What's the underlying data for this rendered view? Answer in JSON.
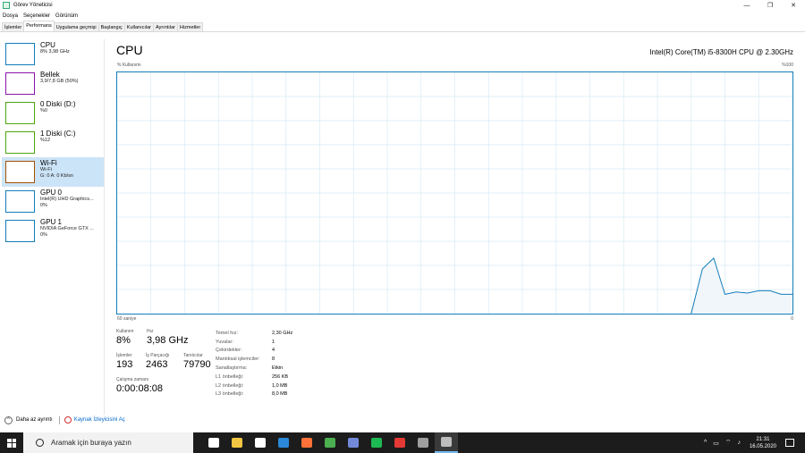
{
  "window": {
    "title": "Görev Yöneticisi",
    "controls": {
      "minimize": "—",
      "restore": "❐",
      "close": "✕"
    }
  },
  "menu": [
    "Dosya",
    "Seçenekler",
    "Görünüm"
  ],
  "tabs": [
    "İşlemler",
    "Performans",
    "Uygulama geçmişi",
    "Başlangıç",
    "Kullanıcılar",
    "Ayrıntılar",
    "Hizmetler"
  ],
  "active_tab": "Performans",
  "sidebar": {
    "items": [
      {
        "name": "CPU",
        "line1": "8%  3,98 GHz",
        "line2": "",
        "color": "#117dbb"
      },
      {
        "name": "Bellek",
        "line1": "3,9/7,8 GB (50%)",
        "line2": "",
        "color": "#8b12ae"
      },
      {
        "name": "0 Diski (D:)",
        "line1": "%0",
        "line2": "",
        "color": "#4da60c"
      },
      {
        "name": "1 Diski (C:)",
        "line1": "%12",
        "line2": "",
        "color": "#4da60c"
      },
      {
        "name": "Wi-Fi",
        "line1": "Wi-Fi",
        "line2": "G: 0  A: 0 Kb/sn",
        "color": "#a74f01"
      },
      {
        "name": "GPU 0",
        "line1": "Intel(R) UHD Graphics...",
        "line2": "0%",
        "color": "#117dbb"
      },
      {
        "name": "GPU 1",
        "line1": "NVIDIA GeForce GTX ...",
        "line2": "0%",
        "color": "#117dbb"
      }
    ],
    "selected_index": 4
  },
  "main": {
    "title": "CPU",
    "cpu_model": "Intel(R) Core(TM) i5-8300H CPU @ 2.30GHz",
    "axis_top_left": "% Kullanımı",
    "axis_top_right": "%100",
    "axis_bottom_left": "60 saniye",
    "axis_bottom_right": "0"
  },
  "stats": {
    "usage_label": "Kullanım",
    "usage_value": "8%",
    "speed_label": "Hız",
    "speed_value": "3,98 GHz",
    "processes_label": "İşlemler",
    "processes_value": "193",
    "threads_label": "İş Parçacığı",
    "threads_value": "2463",
    "handles_label": "Tanıtıcılar",
    "handles_value": "79790",
    "uptime_label": "Çalışma zamanı",
    "uptime_value": "0:00:08:08"
  },
  "properties": [
    {
      "label": "Temel hız:",
      "value": "2,30 GHz"
    },
    {
      "label": "Yuvalar:",
      "value": "1"
    },
    {
      "label": "Çekirdekler:",
      "value": "4"
    },
    {
      "label": "Mantıksal işlemciler:",
      "value": "8"
    },
    {
      "label": "Sanallaştırma:",
      "value": "Etkin"
    },
    {
      "label": "L1 önbelleği:",
      "value": "256 KB"
    },
    {
      "label": "L2 önbelleği:",
      "value": "1,0 MB"
    },
    {
      "label": "L3 önbelleği:",
      "value": "8,0 MB"
    }
  ],
  "footer": {
    "fewer_details": "Daha az ayrıntı",
    "resource_monitor": "Kaynak İzleyicisini Aç"
  },
  "taskbar": {
    "search_placeholder": "Aramak için buraya yazın",
    "time": "21:31",
    "date": "16.05.2020",
    "apps": [
      {
        "icon": "task-view-icon",
        "color": "#ffffff"
      },
      {
        "icon": "file-explorer-icon",
        "color": "#f4c542"
      },
      {
        "icon": "store-icon",
        "color": "#ffffff"
      },
      {
        "icon": "mail-icon",
        "color": "#2b88d8"
      },
      {
        "icon": "firefox-icon",
        "color": "#ff7139"
      },
      {
        "icon": "app-icon",
        "color": "#4caf50"
      },
      {
        "icon": "discord-icon",
        "color": "#7289da"
      },
      {
        "icon": "spotify-icon",
        "color": "#1db954"
      },
      {
        "icon": "flash-app-icon",
        "color": "#e53935"
      },
      {
        "icon": "media-app-icon",
        "color": "#9e9e9e"
      },
      {
        "icon": "task-manager-icon",
        "color": "#bdbdbd"
      }
    ]
  },
  "chart_data": {
    "type": "area",
    "x": [
      60,
      59,
      58,
      57,
      56,
      55,
      54,
      53,
      52,
      51,
      50,
      49,
      48,
      47,
      46,
      45,
      44,
      43,
      42,
      41,
      40,
      39,
      38,
      37,
      36,
      35,
      34,
      33,
      32,
      31,
      30,
      29,
      28,
      27,
      26,
      25,
      24,
      23,
      22,
      21,
      20,
      19,
      18,
      17,
      16,
      15,
      14,
      13,
      12,
      11,
      10,
      9,
      8,
      7,
      6,
      5,
      4,
      3,
      2,
      1,
      0
    ],
    "values": [
      0,
      0,
      0,
      0,
      0,
      0,
      0,
      0,
      0,
      0,
      0,
      0,
      0,
      0,
      0,
      0,
      0,
      0,
      0,
      0,
      0,
      0,
      0,
      0,
      0,
      0,
      0,
      0,
      0,
      0,
      0,
      0,
      0,
      0,
      0,
      0,
      0,
      0,
      0,
      0,
      0,
      0,
      0,
      0,
      0,
      0,
      0,
      0,
      0,
      0,
      0,
      0,
      0,
      0,
      0,
      0,
      0,
      0,
      0,
      0,
      0
    ],
    "points": [
      {
        "x": 9,
        "y": 0
      },
      {
        "x": 8,
        "y": 18.5
      },
      {
        "x": 7,
        "y": 23
      },
      {
        "x": 6,
        "y": 8
      },
      {
        "x": 5,
        "y": 9
      },
      {
        "x": 4,
        "y": 8.5
      },
      {
        "x": 3,
        "y": 9.5
      },
      {
        "x": 2,
        "y": 9.5
      },
      {
        "x": 1,
        "y": 8
      },
      {
        "x": 0,
        "y": 8
      }
    ],
    "xlim": [
      60,
      0
    ],
    "ylim": [
      0,
      100
    ],
    "ylabel": "% Kullanımı",
    "grid": true,
    "color": "#117dbb",
    "fill": "#f1f6fa"
  }
}
